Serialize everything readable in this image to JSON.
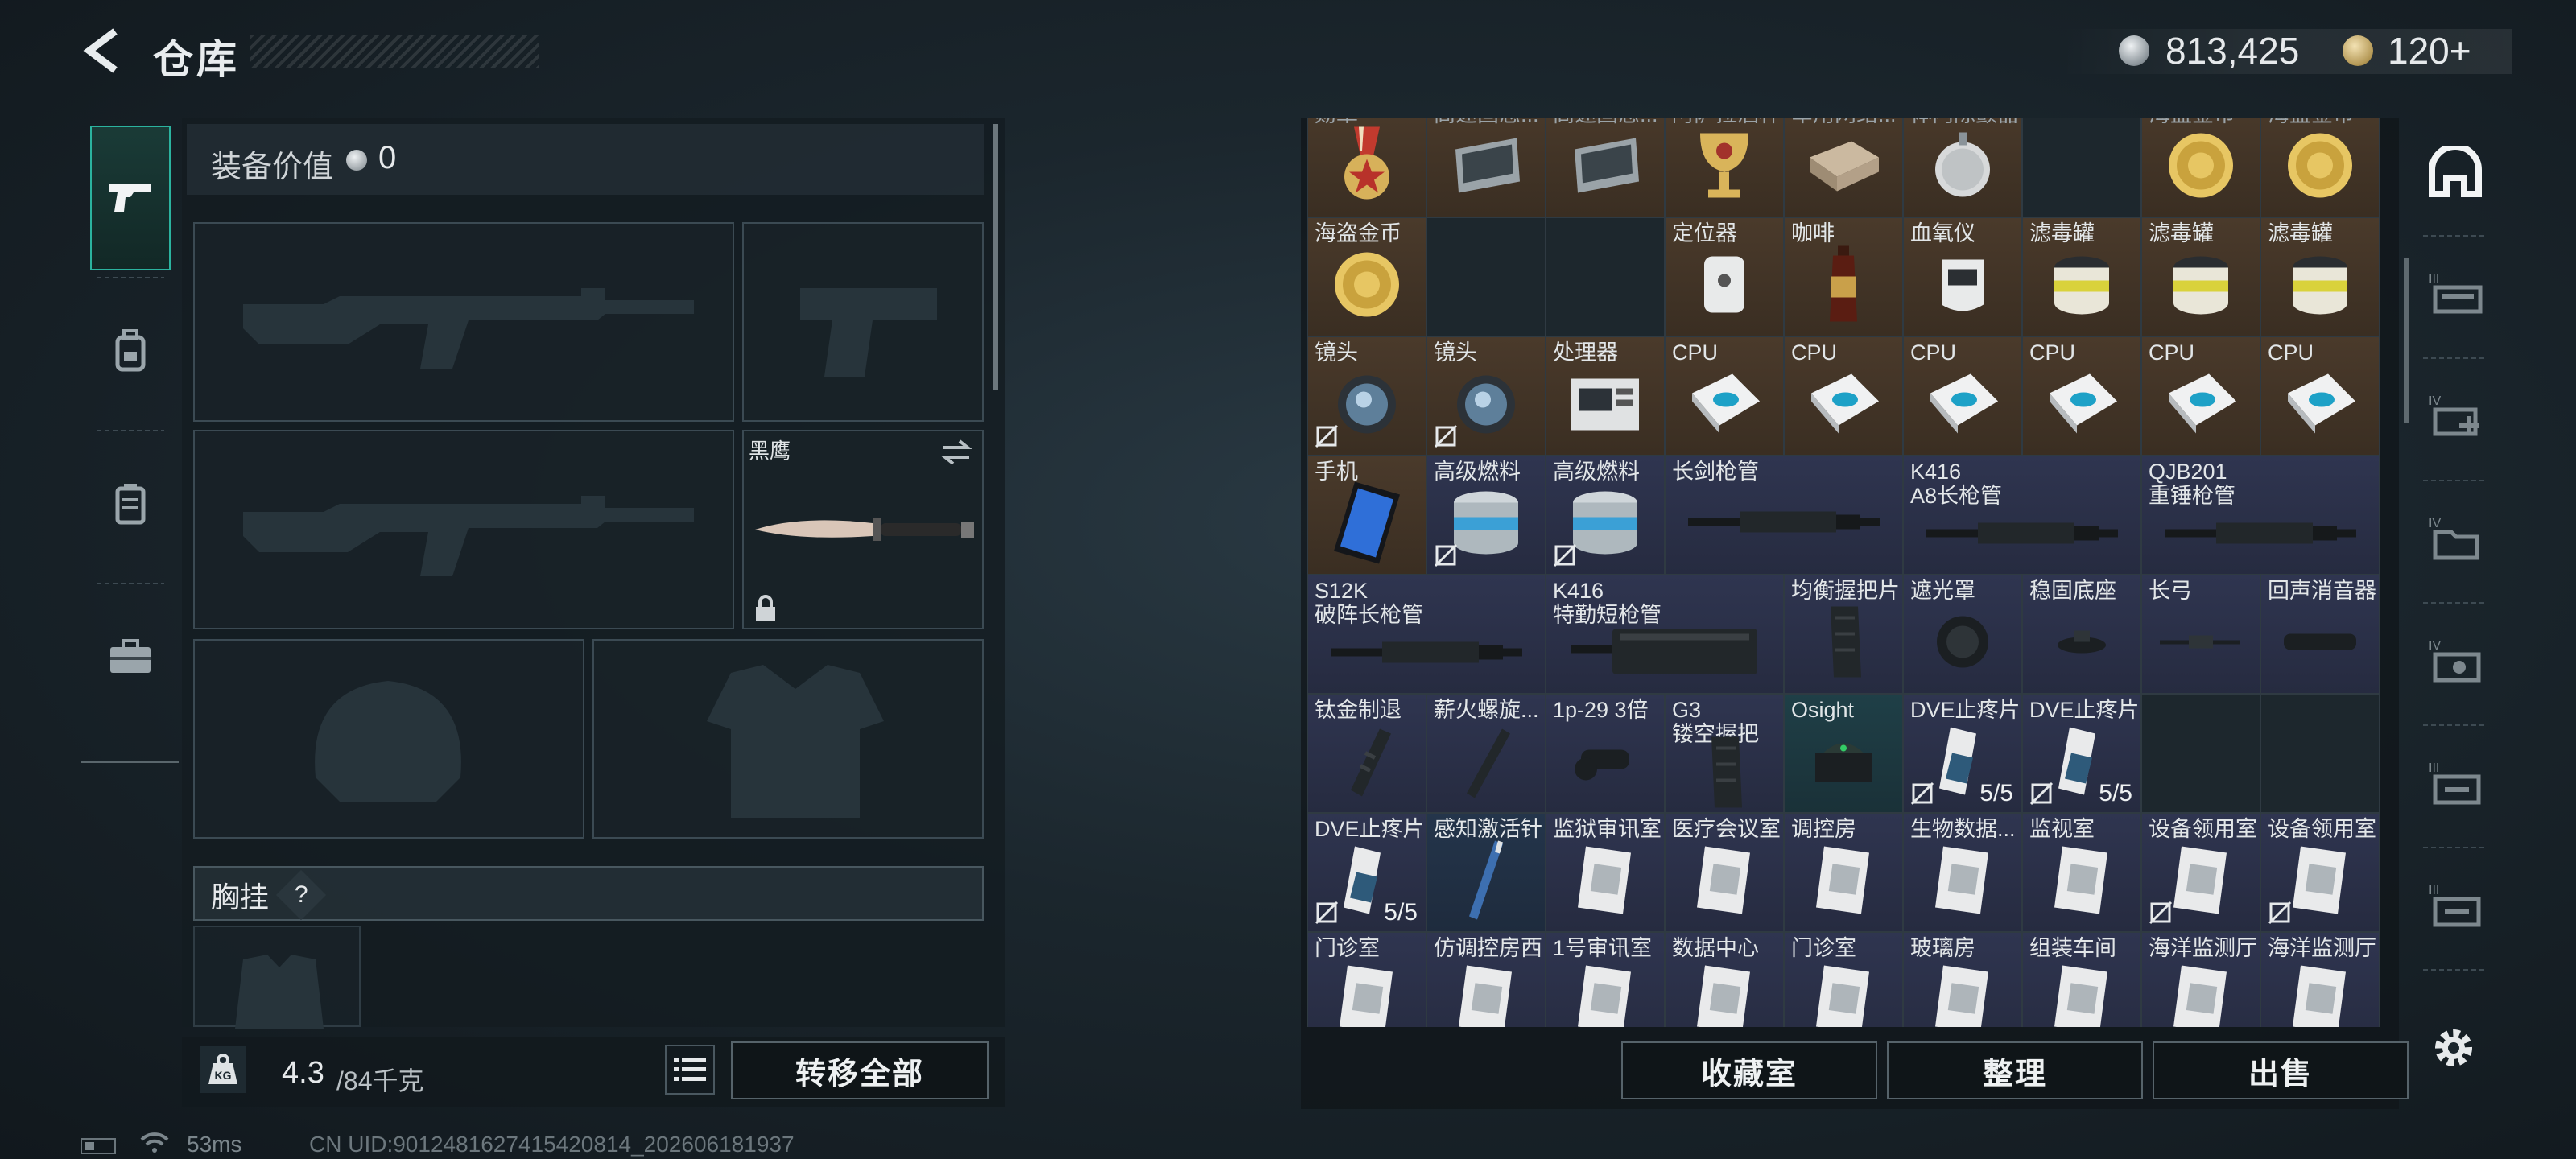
{
  "header": {
    "title": "仓库"
  },
  "currency": {
    "silver": "813,425",
    "gold": "120+"
  },
  "loadout": {
    "value_label": "装备价值",
    "value_amount": "0",
    "knife_name": "黑鹰",
    "chest_label": "胸挂",
    "chest_help": "?",
    "weight_current": "4.3",
    "weight_max": "/84千克",
    "weight_icon_text": "KG",
    "transfer_all_label": "转移全部"
  },
  "grid": {
    "cells": [
      {
        "name": "勋章",
        "color": "brown",
        "icon": "medal-icon"
      },
      {
        "name": "高速固态...",
        "color": "brown",
        "icon": "ssd-icon"
      },
      {
        "name": "高速固态...",
        "color": "brown",
        "icon": "ssd-icon"
      },
      {
        "name": "阿萨拉酒杯",
        "color": "brown",
        "icon": "goblet-icon"
      },
      {
        "name": "军用网络...",
        "color": "brown",
        "icon": "network-module-icon"
      },
      {
        "name": "体内除颤器",
        "color": "brown",
        "icon": "defibrillator-icon"
      },
      {
        "name": "",
        "color": "dark",
        "icon": ""
      },
      {
        "name": "海盗金币",
        "color": "brown",
        "icon": "gold-coin-icon"
      },
      {
        "name": "海盗金币",
        "color": "brown",
        "icon": "gold-coin-icon"
      },
      {
        "name": "海盗金币",
        "color": "brown",
        "icon": "gold-coin-icon"
      },
      {
        "name": "",
        "color": "dark",
        "icon": ""
      },
      {
        "name": "",
        "color": "dark",
        "icon": ""
      },
      {
        "name": "定位器",
        "color": "brown",
        "icon": "locator-icon"
      },
      {
        "name": "咖啡",
        "color": "brown",
        "icon": "coffee-icon"
      },
      {
        "name": "血氧仪",
        "color": "brown",
        "icon": "oximeter-icon"
      },
      {
        "name": "滤毒罐",
        "color": "brown",
        "icon": "filter-canister-icon"
      },
      {
        "name": "滤毒罐",
        "color": "brown",
        "icon": "filter-canister-icon"
      },
      {
        "name": "滤毒罐",
        "color": "brown",
        "icon": "filter-canister-icon"
      },
      {
        "name": "镜头",
        "color": "brown",
        "icon": "lens-icon",
        "nolock": true
      },
      {
        "name": "镜头",
        "color": "brown",
        "icon": "lens-icon",
        "nolock": true
      },
      {
        "name": "处理器",
        "color": "brown",
        "icon": "processor-icon"
      },
      {
        "name": "CPU",
        "color": "brown",
        "icon": "cpu-icon"
      },
      {
        "name": "CPU",
        "color": "brown",
        "icon": "cpu-icon"
      },
      {
        "name": "CPU",
        "color": "brown",
        "icon": "cpu-icon"
      },
      {
        "name": "CPU",
        "color": "brown",
        "icon": "cpu-icon"
      },
      {
        "name": "CPU",
        "color": "brown",
        "icon": "cpu-icon"
      },
      {
        "name": "CPU",
        "color": "brown",
        "icon": "cpu-icon"
      },
      {
        "name": "手机",
        "color": "brown",
        "icon": "phone-icon"
      },
      {
        "name": "高级燃料",
        "color": "navy",
        "icon": "fuel-can-icon",
        "nolock": true
      },
      {
        "name": "高级燃料",
        "color": "navy",
        "icon": "fuel-can-icon",
        "nolock": true
      },
      {
        "name": "长剑枪管",
        "color": "navy",
        "icon": "barrel-icon",
        "wide": true
      },
      {
        "name": "K416\nA8长枪管",
        "color": "navy",
        "icon": "barrel-icon",
        "wide": true
      },
      {
        "name": "QJB201\n重锤枪管",
        "color": "navy",
        "icon": "barrel-icon",
        "wide": true
      },
      {
        "name": "S12K\n破阵长枪管",
        "color": "navy",
        "icon": "barrel-icon",
        "wide": true
      },
      {
        "name": "K416\n特勤短枪管",
        "color": "navy",
        "icon": "handguard-icon",
        "wide": true
      },
      {
        "name": "均衡握把片",
        "color": "navy",
        "icon": "grip-icon"
      },
      {
        "name": "遮光罩",
        "color": "navy",
        "icon": "sunshade-icon"
      },
      {
        "name": "稳固底座",
        "color": "navy",
        "icon": "base-icon"
      },
      {
        "name": "长弓",
        "color": "navy",
        "icon": "longbow-icon"
      },
      {
        "name": "回声消音器",
        "color": "navy",
        "icon": "suppressor-icon"
      },
      {
        "name": "钛金制退",
        "color": "navy",
        "icon": "muzzle-brake-icon"
      },
      {
        "name": "薪火螺旋...",
        "color": "navy",
        "icon": "spiral-icon"
      },
      {
        "name": "1p-29 3倍",
        "color": "navy",
        "icon": "scope-icon"
      },
      {
        "name": "G3\n镂空握把",
        "color": "navy",
        "icon": "grip-icon"
      },
      {
        "name": "Osight",
        "color": "teal",
        "icon": "red-dot-icon"
      },
      {
        "name": "DVE止疼片",
        "color": "navy",
        "icon": "painkiller-icon",
        "nolock": true,
        "stack": "5/5"
      },
      {
        "name": "DVE止疼片",
        "color": "navy",
        "icon": "painkiller-icon",
        "nolock": true,
        "stack": "5/5"
      },
      {
        "name": "",
        "color": "dark",
        "icon": ""
      },
      {
        "name": "",
        "color": "dark",
        "icon": ""
      },
      {
        "name": "DVE止疼片",
        "color": "navy",
        "icon": "painkiller-icon",
        "nolock": true,
        "stack": "5/5"
      },
      {
        "name": "感知激活针",
        "color": "blue2",
        "icon": "injector-icon"
      },
      {
        "name": "监狱审讯室",
        "color": "navy",
        "icon": "keycard-icon"
      },
      {
        "name": "医疗会议室",
        "color": "navy",
        "icon": "keycard-icon"
      },
      {
        "name": "调控房",
        "color": "navy",
        "icon": "keycard-icon"
      },
      {
        "name": "生物数据...",
        "color": "navy",
        "icon": "keycard-icon"
      },
      {
        "name": "监视室",
        "color": "navy",
        "icon": "keycard-icon"
      },
      {
        "name": "设备领用室",
        "color": "navy",
        "icon": "keycard-icon",
        "nolock": true
      },
      {
        "name": "设备领用室",
        "color": "navy",
        "icon": "keycard-icon",
        "nolock": true
      },
      {
        "name": "门诊室",
        "color": "navy",
        "icon": "keycard-icon"
      },
      {
        "name": "仿调控房西",
        "color": "navy",
        "icon": "keycard-icon"
      },
      {
        "name": "1号审讯室",
        "color": "navy",
        "icon": "keycard-icon"
      },
      {
        "name": "数据中心",
        "color": "navy",
        "icon": "keycard-icon"
      },
      {
        "name": "门诊室",
        "color": "navy",
        "icon": "keycard-icon"
      },
      {
        "name": "玻璃房",
        "color": "navy",
        "icon": "keycard-icon"
      },
      {
        "name": "组装车间",
        "color": "navy",
        "icon": "keycard-icon"
      },
      {
        "name": "海洋监测厅",
        "color": "navy",
        "icon": "keycard-icon"
      },
      {
        "name": "海洋监测厅",
        "color": "navy",
        "icon": "keycard-icon"
      }
    ]
  },
  "actions": {
    "collection_label": "收藏室",
    "sort_label": "整理",
    "sell_label": "出售"
  },
  "right_tabs": [
    "home-icon",
    "rack-iii-icon",
    "medkit-iv-icon",
    "folder-iv-icon",
    "case-iv-icon",
    "case-iii-icon",
    "case-iii-icon"
  ],
  "status": {
    "ping": "53ms",
    "uid": "CN UID:9012481627415420814_202606181937"
  },
  "colors": {
    "accent_teal": "#2bb39f",
    "brown_cell": "#4a3a2b",
    "navy_cell": "#2f3550"
  }
}
